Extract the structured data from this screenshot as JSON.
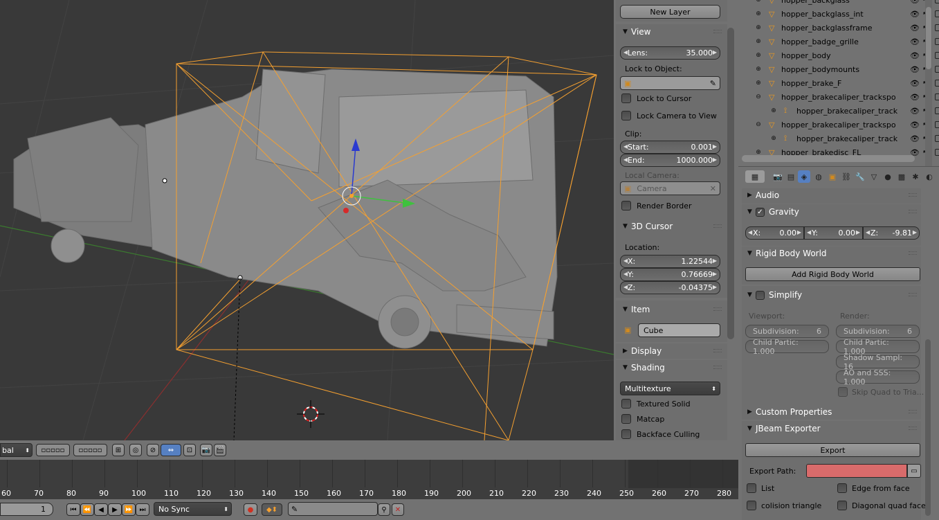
{
  "viewport": {
    "name": "3D Viewport"
  },
  "npanel": {
    "new_layer": "New Layer",
    "view": {
      "header": "View",
      "lens_label": "Lens:",
      "lens_value": "35.000",
      "lock_to_object": "Lock to Object:",
      "lock_to_cursor": "Lock to Cursor",
      "lock_camera_to_view": "Lock Camera to View",
      "clip": "Clip:",
      "start_label": "Start:",
      "start_value": "0.001",
      "end_label": "End:",
      "end_value": "1000.000",
      "local_camera": "Local Camera:",
      "camera_value": "Camera",
      "render_border": "Render Border"
    },
    "cursor3d": {
      "header": "3D Cursor",
      "location": "Location:",
      "x_label": "X:",
      "x_value": "1.22544",
      "y_label": "Y:",
      "y_value": "0.76669",
      "z_label": "Z:",
      "z_value": "-0.04375"
    },
    "item": {
      "header": "Item",
      "name": "Cube"
    },
    "display": {
      "header": "Display"
    },
    "shading": {
      "header": "Shading",
      "mode": "Multitexture",
      "textured_solid": "Textured Solid",
      "matcap": "Matcap",
      "backface_culling": "Backface Culling"
    }
  },
  "outliner": {
    "rows": [
      {
        "name": "hopper_backglass"
      },
      {
        "name": "hopper_backglass_int"
      },
      {
        "name": "hopper_backglassframe"
      },
      {
        "name": "hopper_badge_grille"
      },
      {
        "name": "hopper_body"
      },
      {
        "name": "hopper_bodymounts"
      },
      {
        "name": "hopper_brake_F"
      },
      {
        "name": "hopper_brakecaliper_trackspo"
      },
      {
        "name": "hopper_brakecaliper_track"
      },
      {
        "name": "hopper_brakecaliper_trackspo"
      },
      {
        "name": "hopper_brakecaliper_track"
      },
      {
        "name": "hopper_brakedisc_FL"
      }
    ]
  },
  "properties": {
    "audio": "Audio",
    "gravity": {
      "header": "Gravity",
      "x_label": "X:",
      "x_value": "0.00",
      "y_label": "Y:",
      "y_value": "0.00",
      "z_label": "Z:",
      "z_value": "-9.81"
    },
    "rigid_body_world": {
      "header": "Rigid Body World",
      "add_button": "Add Rigid Body World"
    },
    "simplify": {
      "header": "Simplify",
      "viewport": "Viewport:",
      "render": "Render:",
      "v_subdiv": "Subdivision:",
      "v_subdiv_val": "6",
      "v_child": "Child Partic: 1.000",
      "r_subdiv": "Subdivision:",
      "r_subdiv_val": "6",
      "r_child": "Child Partic: 1.000",
      "r_shadow": "Shadow Sampl: 16",
      "r_ao": "AO and SSS: 1.000",
      "skip_quad": "Skip Quad to Tria..."
    },
    "custom_properties": "Custom Properties",
    "jbeam": {
      "header": "JBeam Exporter",
      "export": "Export",
      "export_path": "Export Path:",
      "list": "List",
      "edge_from_face": "Edge from face",
      "colision_triangle": "colision triangle",
      "diagonal_quad_face": "Diagonal quad face"
    }
  },
  "viewport_header": {
    "orientation": "bal"
  },
  "timeline": {
    "ticks": [
      "60",
      "70",
      "80",
      "90",
      "100",
      "110",
      "120",
      "130",
      "140",
      "150",
      "160",
      "170",
      "180",
      "190",
      "200",
      "210",
      "220",
      "230",
      "240",
      "250",
      "260",
      "270",
      "280"
    ],
    "current_frame": "1",
    "sync": "No Sync"
  },
  "colors": {
    "selection": "#f5a030",
    "export_path_bg": "#d96b6b",
    "grid_x": "#8b2f2f",
    "grid_y": "#3b7a2f"
  }
}
